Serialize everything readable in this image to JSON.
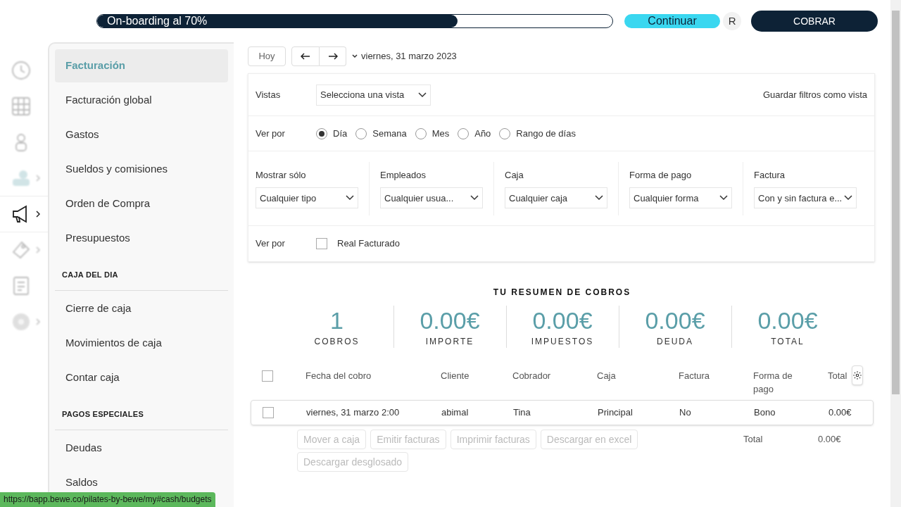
{
  "topbar": {
    "onboarding": {
      "label": "On-boarding al 70%",
      "level": 0.7
    },
    "continue_button": "Continuar",
    "avatar": "R",
    "charge_button": "COBRAR"
  },
  "rail": [
    {
      "selected": false,
      "expandable": false
    },
    {
      "selected": false,
      "expandable": false
    },
    {
      "selected": false,
      "expandable": false
    },
    {
      "selected": false,
      "expandable": true
    },
    {
      "selected": true,
      "expandable": true
    },
    {
      "selected": false,
      "expandable": true
    },
    {
      "selected": false,
      "expandable": false
    },
    {
      "selected": false,
      "expandable": true
    }
  ],
  "submenu": [
    {
      "kind": "item",
      "label": "Facturación",
      "selected": true
    },
    {
      "kind": "item",
      "label": "Facturación global",
      "selected": false
    },
    {
      "kind": "item",
      "label": "Gastos",
      "selected": false
    },
    {
      "kind": "item",
      "label": "Sueldos y comisiones",
      "selected": false
    },
    {
      "kind": "item",
      "label": "Orden de Compra",
      "selected": false
    },
    {
      "kind": "item",
      "label": "Presupuestos",
      "selected": false
    },
    {
      "kind": "heading",
      "label": "CAJA DEL DIA"
    },
    {
      "kind": "item",
      "label": "Cierre de caja",
      "selected": false
    },
    {
      "kind": "item",
      "label": "Movimientos de caja",
      "selected": false
    },
    {
      "kind": "item",
      "label": "Contar caja",
      "selected": false
    },
    {
      "kind": "heading",
      "label": "PAGOS ESPECIALES"
    },
    {
      "kind": "item",
      "label": "Deudas",
      "selected": false
    },
    {
      "kind": "item",
      "label": "Saldos",
      "selected": false
    }
  ],
  "date_nav": {
    "today": "Hoy",
    "date": "viernes, 31 marzo 2023"
  },
  "filters": {
    "views_label": "Vistas",
    "views_select": "Selecciona una vista",
    "save_link": "Guardar filtros como vista",
    "period_label": "Ver por",
    "periods": [
      {
        "label": "Día",
        "selected": true
      },
      {
        "label": "Semana",
        "selected": false
      },
      {
        "label": "Mes",
        "selected": false
      },
      {
        "label": "Año",
        "selected": false
      },
      {
        "label": "Rango de días",
        "selected": false
      }
    ],
    "selects": [
      {
        "label": "Mostrar sólo",
        "value": "Cualquier tipo"
      },
      {
        "label": "Empleados",
        "value": "Cualquier usua..."
      },
      {
        "label": "Caja",
        "value": "Cualquier caja"
      },
      {
        "label": "Forma de pago",
        "value": "Cualquier forma"
      },
      {
        "label": "Factura",
        "value": "Con y sin factura e..."
      }
    ],
    "real_label": "Ver por",
    "real_checkbox": {
      "label": "Real Facturado",
      "checked": false
    }
  },
  "summary": {
    "title": "TU RESUMEN DE COBROS",
    "stats": [
      {
        "value": "1",
        "label": "COBROS"
      },
      {
        "value": "0.00€",
        "label": "IMPORTE"
      },
      {
        "value": "0.00€",
        "label": "IMPUESTOS"
      },
      {
        "value": "0.00€",
        "label": "DEUDA"
      },
      {
        "value": "0.00€",
        "label": "TOTAL"
      }
    ]
  },
  "table": {
    "select_all_checked": false,
    "columns": [
      "Fecha del cobro",
      "Cliente",
      "Cobrador",
      "Caja",
      "Factura",
      "Forma de pago",
      "Total"
    ],
    "rows": [
      {
        "checked": false,
        "cells": [
          "viernes, 31 marzo 2:00",
          "abimal",
          "Tina",
          "Principal",
          "No",
          "Bono",
          "0.00€"
        ]
      }
    ],
    "actions": [
      {
        "label": "Mover a caja",
        "disabled": true
      },
      {
        "label": "Emitir facturas",
        "disabled": true
      },
      {
        "label": "Imprimir facturas",
        "disabled": true
      },
      {
        "label": "Descargar en excel",
        "disabled": true
      },
      {
        "label": "Descargar desglosado",
        "disabled": true
      }
    ],
    "total_label": "Total",
    "total_value": "0.00€"
  },
  "status_url": "https://bapp.bewe.co/pilates-by-bewe/my#cash/budgets"
}
